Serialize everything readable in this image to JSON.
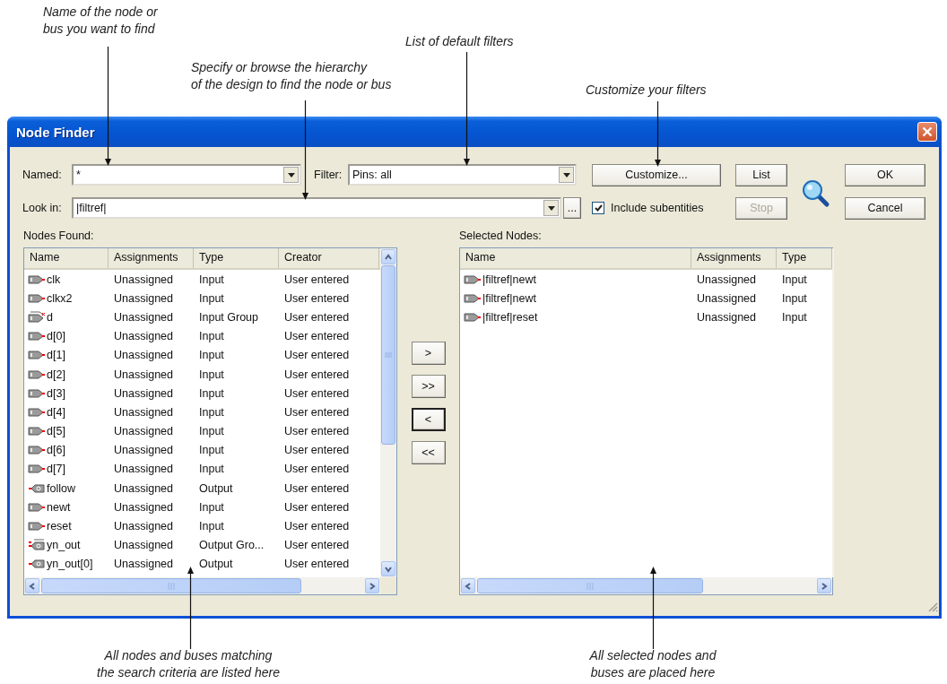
{
  "annotations": [
    {
      "text": "Name of the node or\nbus you want to find"
    },
    {
      "text": "List of default filters"
    },
    {
      "text": "Specify or browse the hierarchy\nof the design to find the node or bus"
    },
    {
      "text": "Customize your filters"
    },
    {
      "text": "All nodes and buses matching\nthe search criteria are listed here"
    },
    {
      "text": "All selected nodes and\nbuses are placed here"
    }
  ],
  "window": {
    "title": "Node Finder"
  },
  "named": {
    "label": "Named:",
    "value": "*"
  },
  "filter": {
    "label": "Filter:",
    "value": "Pins: all"
  },
  "look_in": {
    "label": "Look in:",
    "value": "|filtref|"
  },
  "browse_button": "...",
  "customize_button": "Customize...",
  "list_button": "List",
  "stop_button": {
    "label": "Stop",
    "disabled": true
  },
  "include_subentities": {
    "label": "Include subentities",
    "checked": true
  },
  "ok_button": "OK",
  "cancel_button": "Cancel",
  "nodes_found": {
    "label": "Nodes Found:",
    "columns": [
      "Name",
      "Assignments",
      "Type",
      "Creator"
    ],
    "rows": [
      {
        "kind": "input",
        "cells": [
          "clk",
          "Unassigned",
          "Input",
          "User entered"
        ]
      },
      {
        "kind": "input",
        "cells": [
          "clkx2",
          "Unassigned",
          "Input",
          "User entered"
        ]
      },
      {
        "kind": "input_group",
        "cells": [
          "d",
          "Unassigned",
          "Input Group",
          "User entered"
        ]
      },
      {
        "kind": "input",
        "cells": [
          "d[0]",
          "Unassigned",
          "Input",
          "User entered"
        ]
      },
      {
        "kind": "input",
        "cells": [
          "d[1]",
          "Unassigned",
          "Input",
          "User entered"
        ]
      },
      {
        "kind": "input",
        "cells": [
          "d[2]",
          "Unassigned",
          "Input",
          "User entered"
        ]
      },
      {
        "kind": "input",
        "cells": [
          "d[3]",
          "Unassigned",
          "Input",
          "User entered"
        ]
      },
      {
        "kind": "input",
        "cells": [
          "d[4]",
          "Unassigned",
          "Input",
          "User entered"
        ]
      },
      {
        "kind": "input",
        "cells": [
          "d[5]",
          "Unassigned",
          "Input",
          "User entered"
        ]
      },
      {
        "kind": "input",
        "cells": [
          "d[6]",
          "Unassigned",
          "Input",
          "User entered"
        ]
      },
      {
        "kind": "input",
        "cells": [
          "d[7]",
          "Unassigned",
          "Input",
          "User entered"
        ]
      },
      {
        "kind": "output",
        "cells": [
          "follow",
          "Unassigned",
          "Output",
          "User entered"
        ]
      },
      {
        "kind": "input",
        "cells": [
          "newt",
          "Unassigned",
          "Input",
          "User entered"
        ]
      },
      {
        "kind": "input",
        "cells": [
          "reset",
          "Unassigned",
          "Input",
          "User entered"
        ]
      },
      {
        "kind": "output_group",
        "cells": [
          "yn_out",
          "Unassigned",
          "Output Gro...",
          "User entered"
        ]
      },
      {
        "kind": "output",
        "cells": [
          "yn_out[0]",
          "Unassigned",
          "Output",
          "User entered"
        ]
      }
    ]
  },
  "transfer_buttons": [
    {
      "label": ">",
      "focused": false
    },
    {
      "label": ">>",
      "focused": false
    },
    {
      "label": "<",
      "focused": true
    },
    {
      "label": "<<",
      "focused": false
    }
  ],
  "selected_nodes": {
    "label": "Selected Nodes:",
    "columns": [
      "Name",
      "Assignments",
      "Type"
    ],
    "rows": [
      {
        "kind": "input",
        "cells": [
          "|filtref|newt",
          "Unassigned",
          "Input"
        ]
      },
      {
        "kind": "input",
        "cells": [
          "|filtref|newt",
          "Unassigned",
          "Input"
        ]
      },
      {
        "kind": "input",
        "cells": [
          "|filtref|reset",
          "Unassigned",
          "Input"
        ]
      }
    ]
  }
}
